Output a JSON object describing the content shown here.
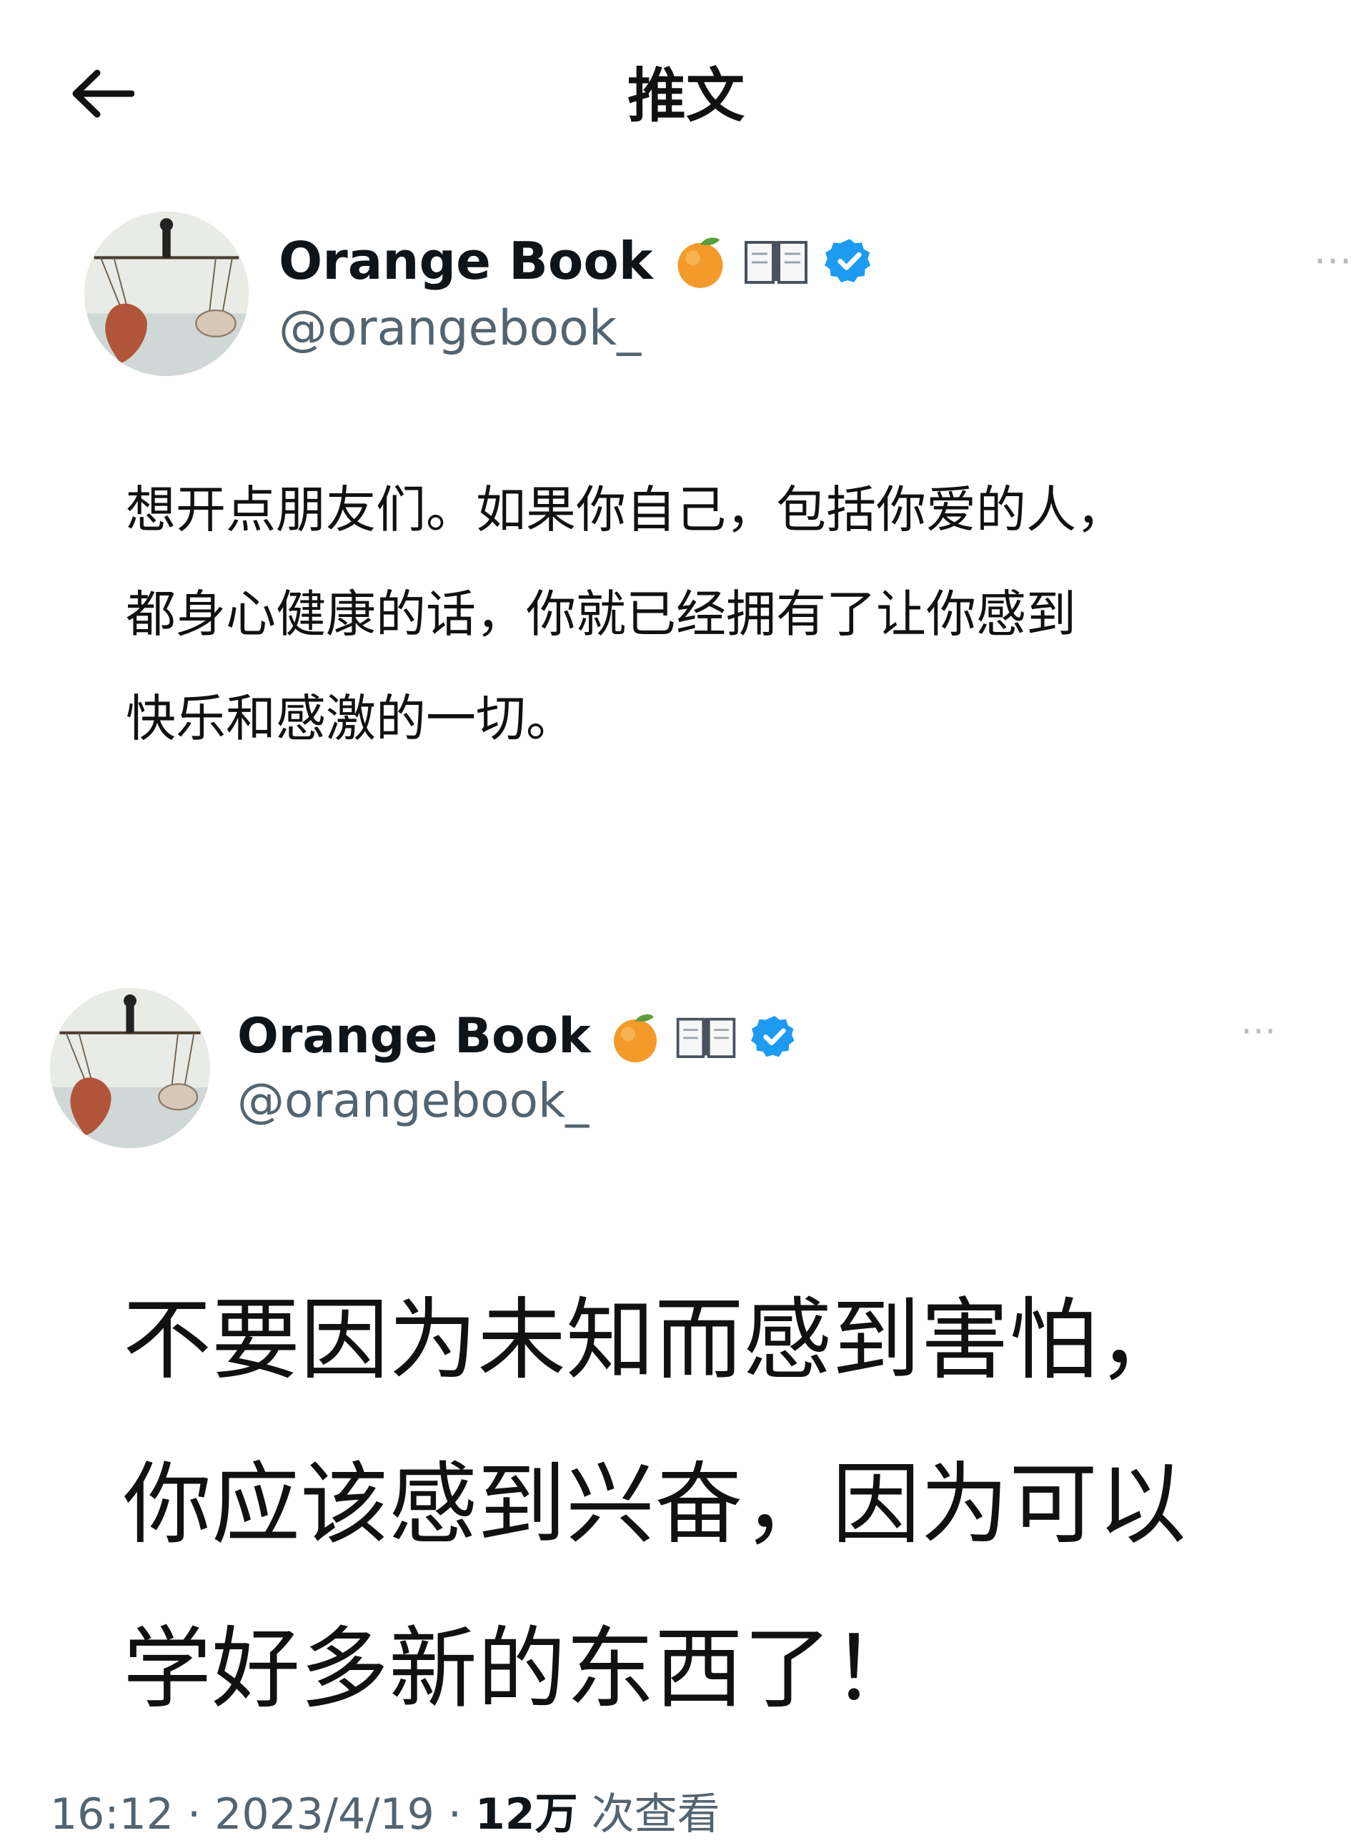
{
  "header": {
    "title": "推文",
    "back_icon": "arrow-left-icon"
  },
  "tweets": [
    {
      "display_name": "Orange Book",
      "handle": "@orangebook_",
      "badges": [
        "orange-emoji-icon",
        "book-emoji-icon",
        "verified-badge-icon"
      ],
      "text_lines": [
        "想开点朋友们。如果你自己，包括你爱的人，",
        "都身心健康的话，你就已经拥有了让你感到",
        "快乐和感激的一切。"
      ]
    },
    {
      "display_name": "Orange Book",
      "handle": "@orangebook_",
      "badges": [
        "orange-emoji-icon",
        "book-emoji-icon",
        "verified-badge-icon"
      ],
      "text_lines": [
        "不要因为未知而感到害怕，",
        "你应该感到兴奋，因为可以",
        "学好多新的东西了！"
      ]
    }
  ],
  "meta": {
    "time": "16:12",
    "separator": "·",
    "date": "2023/4/19",
    "views_count": "12万",
    "views_label": "次查看"
  },
  "colors": {
    "verified": "#1d9bf0",
    "handle": "#536471",
    "text": "#0f1419"
  }
}
